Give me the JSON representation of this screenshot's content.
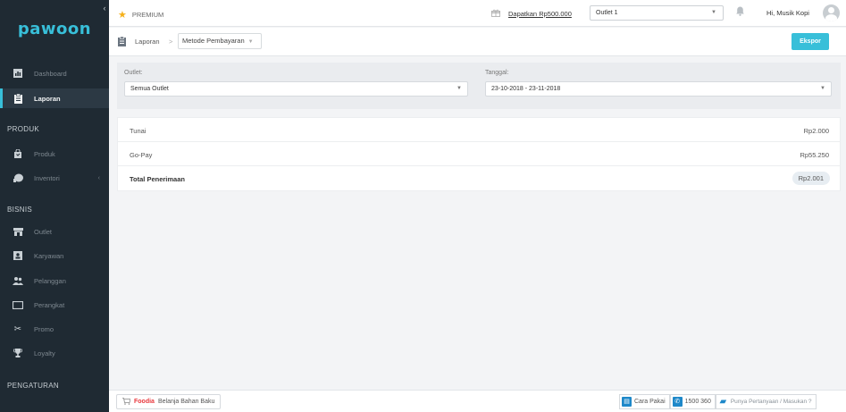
{
  "sidebar": {
    "logo": "pawoon",
    "collapse_icon": "‹",
    "items_top": [
      {
        "label": "Dashboard",
        "icon": "chart-icon"
      },
      {
        "label": "Laporan",
        "icon": "clipboard-icon",
        "active": true
      }
    ],
    "section_produk": "PRODUK",
    "items_produk": [
      {
        "label": "Produk",
        "icon": "bag-icon"
      },
      {
        "label": "Inventori",
        "icon": "box-icon"
      }
    ],
    "section_bisnis": "BISNIS",
    "items_bisnis": [
      {
        "label": "Outlet",
        "icon": "store-icon"
      },
      {
        "label": "Karyawan",
        "icon": "id-card-icon"
      },
      {
        "label": "Pelanggan",
        "icon": "users-icon"
      },
      {
        "label": "Perangkat",
        "icon": "tablet-icon"
      },
      {
        "label": "Promo",
        "icon": "scissors-icon"
      },
      {
        "label": "Loyalty",
        "icon": "trophy-icon"
      }
    ],
    "section_pengaturan": "PENGATURAN"
  },
  "topbar": {
    "premium": "PREMIUM",
    "promo_link": "Dapatkan Rp500.000",
    "outlet_selected": "Outlet 1",
    "greeting": "Hi, Musik Kopi"
  },
  "breadcrumb": {
    "home": "Laporan",
    "separator": ">",
    "current": "Metode Pembayaran"
  },
  "export_label": "Ekspor",
  "filters": {
    "outlet_label": "Outlet:",
    "outlet_value": "Semua Outlet",
    "date_label": "Tanggal:",
    "date_value": "23-10-2018 - 23-11-2018"
  },
  "table": {
    "rows": [
      {
        "label": "Tunai",
        "value": "Rp2.000"
      },
      {
        "label": "Go-Pay",
        "value": "Rp55.250"
      }
    ],
    "total": {
      "label": "Total Penerimaan",
      "value": "Rp2.001"
    }
  },
  "bottombar": {
    "foodia_brand": "Foodia",
    "foodia_text": "Belanja Bahan Baku",
    "cara_pakai": "Cara Pakai",
    "phone": "1500 360",
    "question": "Punya Pertanyaan / Masukan ?"
  },
  "colors": {
    "accent": "#38bfd9",
    "sidebar_bg": "#1f2a33",
    "star": "#f5b019",
    "foodia": "#e8383d"
  }
}
